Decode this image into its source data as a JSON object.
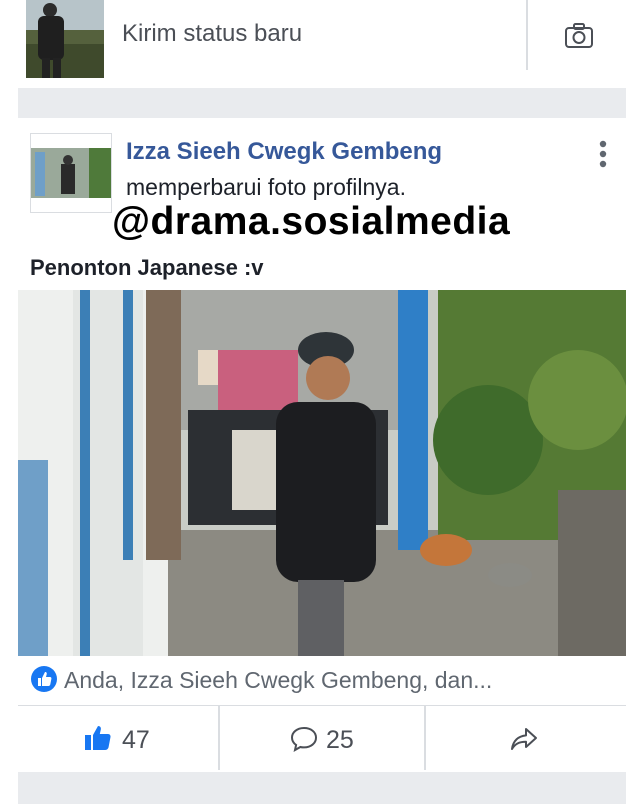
{
  "composer": {
    "placeholder": "Kirim status baru",
    "camera_icon": "camera-icon"
  },
  "post": {
    "author": "Izza Sieeh Cwegk Gembeng",
    "action": "memperbarui foto profilnya.",
    "watermark": "@drama.sosialmedia",
    "caption": "Penonton Japanese :v",
    "likers": "Anda, Izza Sieeh Cwegk Gembeng, dan...",
    "like_count": "47",
    "comment_count": "25"
  },
  "colors": {
    "link_blue": "#365899",
    "like_blue": "#1877f2",
    "band_gray": "#e9ebee"
  }
}
